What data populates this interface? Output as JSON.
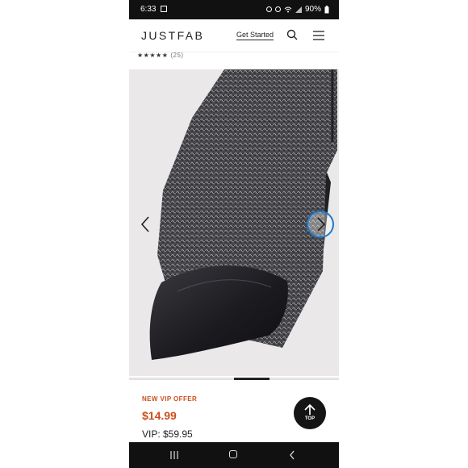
{
  "status_bar": {
    "time": "6:33",
    "battery": "90%"
  },
  "header": {
    "logo": "JUSTFAB",
    "get_started": "Get Started"
  },
  "rating": {
    "stars": "★★★★★",
    "count": "(25)"
  },
  "product": {
    "new_vip_offer": "NEW VIP OFFER",
    "offer_price": "$14.99",
    "vip_price": "VIP: $59.95"
  },
  "top_button": {
    "label": "TOP"
  },
  "carousel": {
    "current_index": 3,
    "total": 6
  },
  "colors": {
    "accent": "#c94f1d",
    "selection_ring": "#1a7ad0",
    "dark": "#111111"
  }
}
